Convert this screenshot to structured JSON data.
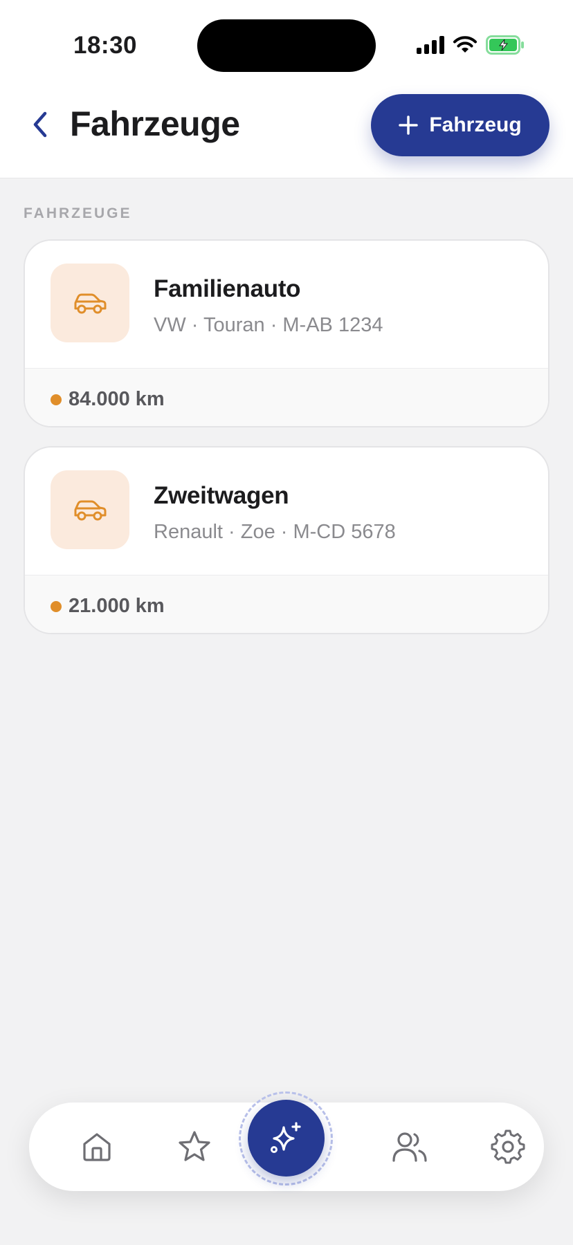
{
  "status_bar": {
    "time": "18:30"
  },
  "header": {
    "title": "Fahrzeuge",
    "add_button_label": "Fahrzeug"
  },
  "section": {
    "label": "FAHRZEUGE"
  },
  "vehicles": [
    {
      "name": "Familienauto",
      "meta": "VW · Touran · M-AB 1234",
      "mileage": "84.000 km"
    },
    {
      "name": "Zweitwagen",
      "meta": "Renault · Zoe · M-CD 5678",
      "mileage": "21.000 km"
    }
  ],
  "colors": {
    "accent": "#263a93",
    "car_icon": "#e08e2a",
    "car_tile_bg": "#fbeadd",
    "battery": "#34c759"
  },
  "tabbar": {
    "icons": [
      "home-icon",
      "star-icon",
      "sparkles-icon",
      "users-icon",
      "gear-icon"
    ]
  }
}
